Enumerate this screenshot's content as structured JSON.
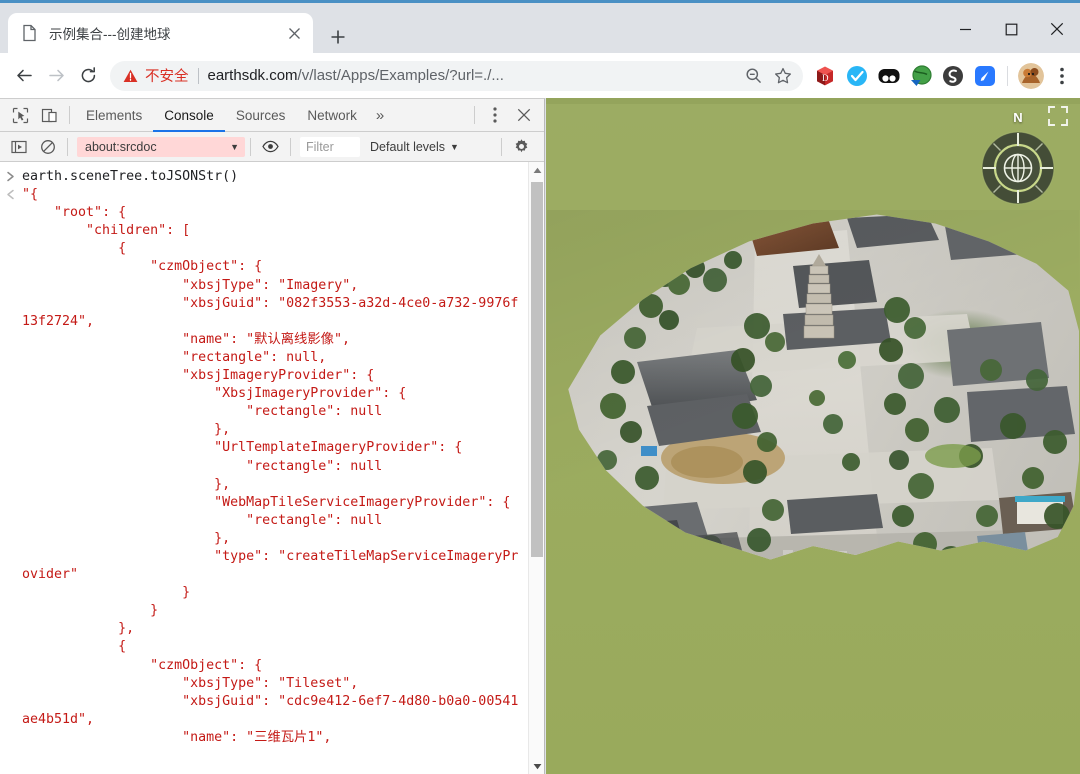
{
  "window": {
    "controls": [
      {
        "name": "minimize",
        "label": "—"
      },
      {
        "name": "maximize",
        "label": "□"
      },
      {
        "name": "close",
        "label": "✕"
      }
    ]
  },
  "browser": {
    "tab": {
      "title": "示例集合---创建地球",
      "favicon": "document-icon",
      "close_label": "✕"
    },
    "new_tab_label": "+",
    "toolbar": {
      "back_label": "←",
      "forward_label": "→",
      "reload_label": "↻",
      "security_warning": "不安全",
      "url_domain": "earthsdk.com",
      "url_path": "/v/last/Apps/Examples/?url=./...",
      "zoom_out_icon": "zoom-out-icon",
      "bookmark_icon": "star-icon",
      "menu_icon": "kebab-menu-icon",
      "extensions": [
        {
          "name": "extension-red-cube",
          "color": "#d32f2f"
        },
        {
          "name": "extension-blue-check",
          "color": "#29b6f6"
        },
        {
          "name": "extension-black-eyes",
          "color": "#1b1b1b"
        },
        {
          "name": "extension-globe-download",
          "color": "#43a047"
        },
        {
          "name": "extension-dark-swirl",
          "color": "#3c3c3c"
        },
        {
          "name": "extension-blue-note",
          "color": "#2979ff"
        }
      ],
      "profile_avatar": "user-avatar"
    }
  },
  "devtools": {
    "inspect_icon": "inspect-element-icon",
    "device_toolbar_icon": "device-toolbar-icon",
    "tabs": [
      {
        "label": "Elements",
        "active": false
      },
      {
        "label": "Console",
        "active": true
      },
      {
        "label": "Sources",
        "active": false
      },
      {
        "label": "Network",
        "active": false
      }
    ],
    "more_tabs_label": "»",
    "settings_icon": "gear-icon",
    "more_options_icon": "kebab-menu-icon",
    "close_label": "✕",
    "console_toolbar": {
      "sidebar_toggle_icon": "console-sidebar-icon",
      "clear_icon": "clear-console-icon",
      "context_value": "about:srcdoc",
      "context_caret": "▼",
      "eye_icon": "live-expression-icon",
      "filter_placeholder": "Filter",
      "levels_label": "Default levels",
      "levels_caret": "▼"
    },
    "console": {
      "prompt_marker": "›",
      "result_marker": "‹",
      "command": "earth.sceneTree.toJSONStr()",
      "result": "\"{\n    \"root\": {\n        \"children\": [\n            {\n                \"czmObject\": {\n                    \"xbsjType\": \"Imagery\",\n                    \"xbsjGuid\": \"082f3553-a32d-4ce0-a732-9976f13f2724\",\n                    \"name\": \"默认离线影像\",\n                    \"rectangle\": null,\n                    \"xbsjImageryProvider\": {\n                        \"XbsjImageryProvider\": {\n                            \"rectangle\": null\n                        },\n                        \"UrlTemplateImageryProvider\": {\n                            \"rectangle\": null\n                        },\n                        \"WebMapTileServiceImageryProvider\": {\n                            \"rectangle\": null\n                        },\n                        \"type\": \"createTileMapServiceImageryProvider\"\n                    }\n                }\n            },\n            {\n                \"czmObject\": {\n                    \"xbsjType\": \"Tileset\",\n                    \"xbsjGuid\": \"cdc9e412-6ef7-4d80-b0a0-00541ae4b51d\",\n                    \"name\": \"三维瓦片1\","
    },
    "scrollbar": {
      "up_arrow": "▲",
      "down_arrow": "▼"
    }
  },
  "viewport": {
    "compass_north_label": "N",
    "compass_icon": "compass-navigation-icon",
    "fullscreen_icon": "fullscreen-icon",
    "background_color": "#9aab5e",
    "scene_description": "3D photogrammetry tileset of Giant Wild Goose Pagoda district"
  }
}
